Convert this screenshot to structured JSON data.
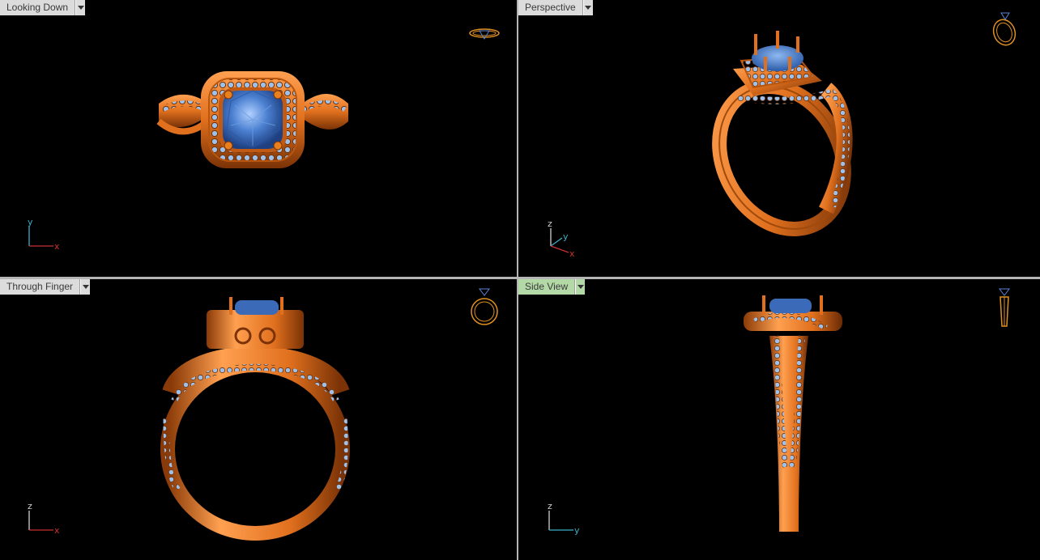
{
  "viewports": [
    {
      "label": "Looking Down",
      "active": false,
      "axes": [
        "y",
        "x"
      ]
    },
    {
      "label": "Perspective",
      "active": false,
      "axes": [
        "z",
        "y",
        "x"
      ]
    },
    {
      "label": "Through Finger",
      "active": false,
      "axes": [
        "z",
        "x"
      ]
    },
    {
      "label": "Side View",
      "active": true,
      "axes": [
        "z",
        "y"
      ]
    }
  ],
  "colors": {
    "metal": "#e0701e",
    "metal_dark": "#8a3a08",
    "metal_light": "#ffa050",
    "gem": "#4a7fd0",
    "gem_light": "#a8c8f0",
    "active_tab": "#b3d9a6",
    "tab": "#dcdcdc",
    "axis_x": "#c83030",
    "axis_y": "#3ab0c8",
    "axis_z": "#d0d0d0"
  }
}
